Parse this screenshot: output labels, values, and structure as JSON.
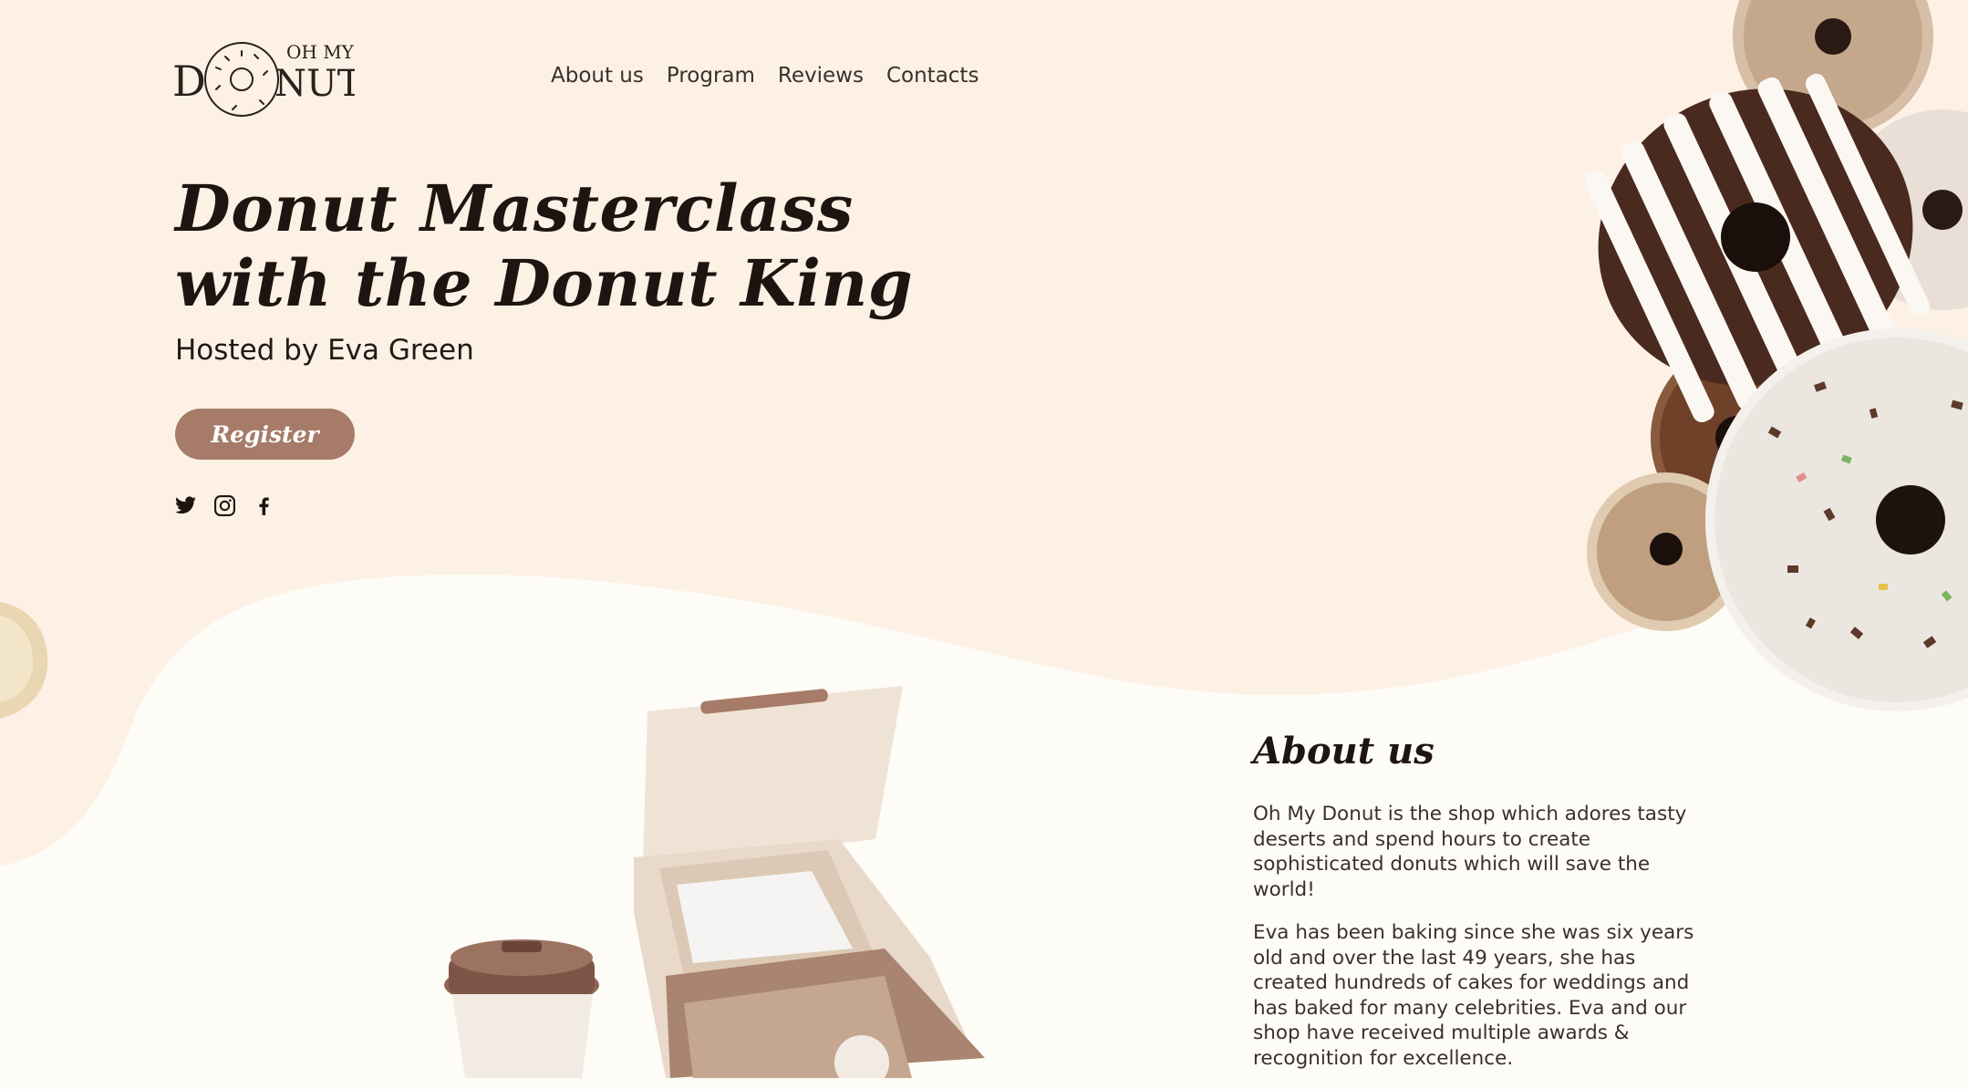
{
  "brand": {
    "logo_top_text": "OH MY",
    "logo_bottom_left": "D",
    "logo_bottom_right": "NUT"
  },
  "nav": {
    "items": [
      "About us",
      "Program",
      "Reviews",
      "Contacts"
    ]
  },
  "hero": {
    "title_line1": "Donut Masterclass",
    "title_line2": "with the Donut King",
    "subtitle": "Hosted by Eva Green",
    "register_label": "Register"
  },
  "social": {
    "icons": [
      "twitter-icon",
      "instagram-icon",
      "facebook-icon"
    ]
  },
  "about": {
    "heading": "About us",
    "paragraph1": "Oh My Donut is the shop which adores tasty deserts and spend hours to create sophisticated donuts which will save the world!",
    "paragraph2": "Eva has been baking since she was six years old and over the last 49 years, she has created hundreds of cakes for weddings and has baked for many celebrities. Eva and our shop have received multiple awards & recognition for excellence."
  },
  "colors": {
    "hero_bg": "#fdf1e6",
    "page_bg": "#fefcf6",
    "accent": "#a67b68",
    "text_dark": "#1e1410"
  }
}
